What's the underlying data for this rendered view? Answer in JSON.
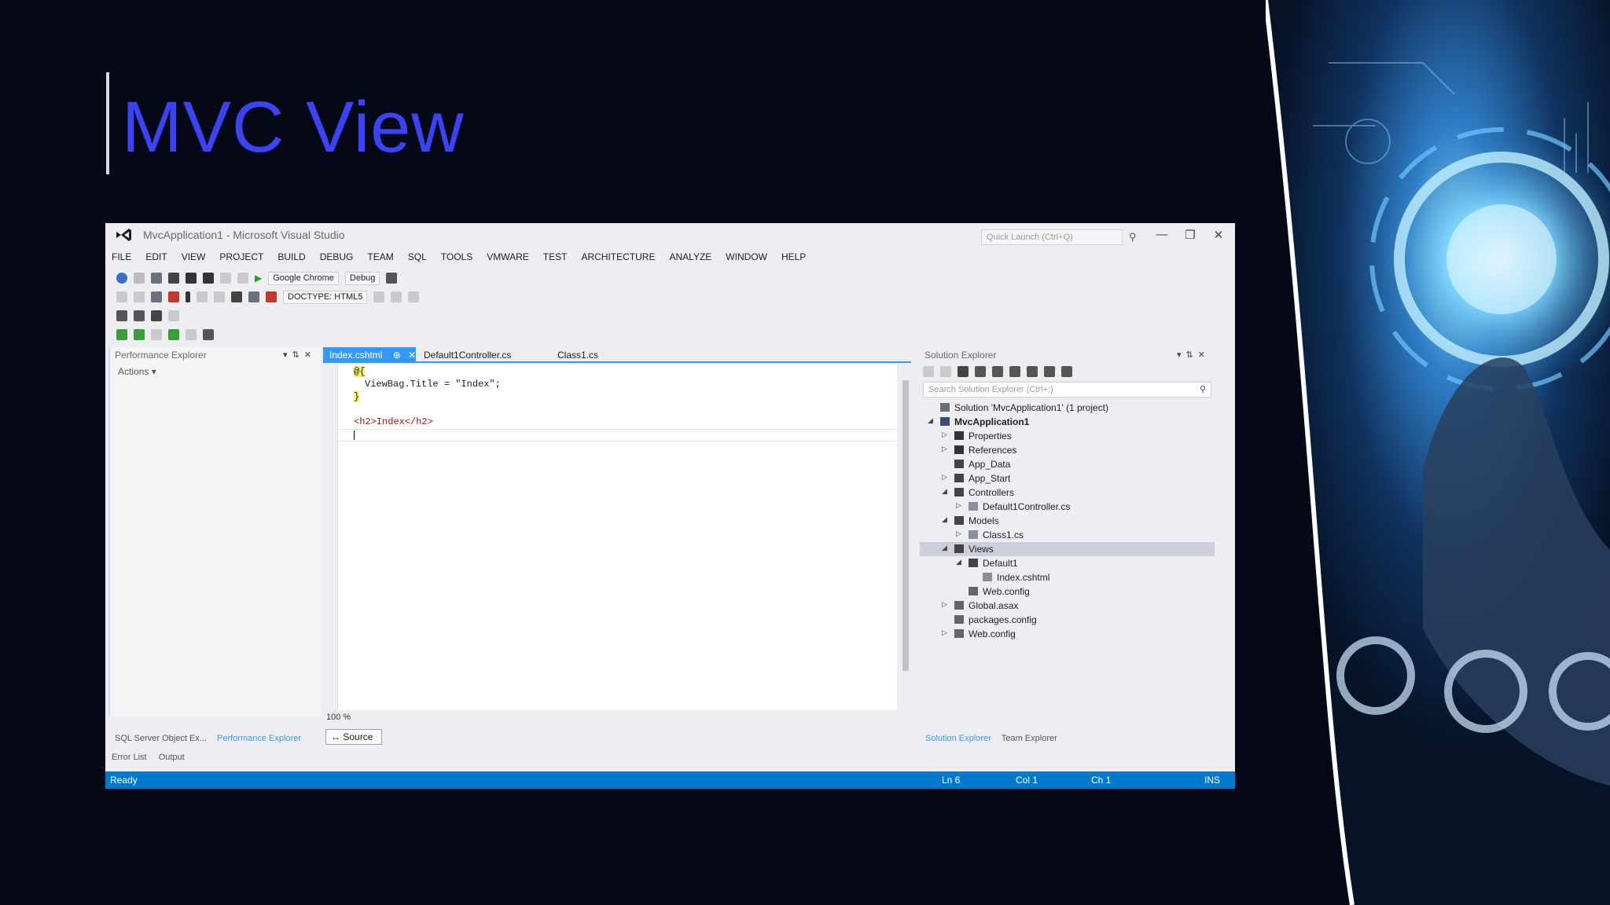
{
  "slide": {
    "title": "MVC View"
  },
  "window": {
    "title": "MvcApplication1 - Microsoft Visual Studio",
    "quick_launch_placeholder": "Quick Launch (Ctrl+Q)"
  },
  "menu": [
    "FILE",
    "EDIT",
    "VIEW",
    "PROJECT",
    "BUILD",
    "DEBUG",
    "TEAM",
    "SQL",
    "TOOLS",
    "VMWARE",
    "TEST",
    "ARCHITECTURE",
    "ANALYZE",
    "WINDOW",
    "HELP"
  ],
  "toolbar": {
    "browser": "Google Chrome",
    "config": "Debug",
    "doctype": "DOCTYPE: HTML5"
  },
  "left_panel": {
    "title": "Performance Explorer",
    "actions": "Actions"
  },
  "tabs": [
    "Index.cshtml",
    "Default1Controller.cs",
    "Class1.cs"
  ],
  "code": {
    "line1": "@{",
    "line2": "ViewBag.Title = \"Index\";",
    "line3": "}",
    "line4": "<h2>Index</h2>"
  },
  "zoom": "100 %",
  "source_button": "Source",
  "solution_explorer": {
    "title": "Solution Explorer",
    "search_placeholder": "Search Solution Explorer (Ctrl+;)",
    "items": [
      {
        "label": "Solution 'MvcApplication1' (1 project)",
        "level": 0,
        "arrow": "",
        "icon": "solution-icon"
      },
      {
        "label": "MvcApplication1",
        "level": 0,
        "arrow": "open",
        "icon": "project-icon"
      },
      {
        "label": "Properties",
        "level": 1,
        "arrow": "closed",
        "icon": "wrench-icon"
      },
      {
        "label": "References",
        "level": 1,
        "arrow": "closed",
        "icon": "references-icon"
      },
      {
        "label": "App_Data",
        "level": 1,
        "arrow": "",
        "icon": "folder-icon"
      },
      {
        "label": "App_Start",
        "level": 1,
        "arrow": "closed",
        "icon": "folder-icon"
      },
      {
        "label": "Controllers",
        "level": 1,
        "arrow": "open",
        "icon": "folder-icon"
      },
      {
        "label": "Default1Controller.cs",
        "level": 2,
        "arrow": "closed",
        "icon": "csharp-file-icon"
      },
      {
        "label": "Models",
        "level": 1,
        "arrow": "open",
        "icon": "folder-icon"
      },
      {
        "label": "Class1.cs",
        "level": 2,
        "arrow": "closed",
        "icon": "csharp-file-icon"
      },
      {
        "label": "Views",
        "level": 1,
        "arrow": "open",
        "icon": "folder-icon"
      },
      {
        "label": "Default1",
        "level": 2,
        "arrow": "open",
        "icon": "folder-icon"
      },
      {
        "label": "Index.cshtml",
        "level": 3,
        "arrow": "",
        "icon": "cshtml-file-icon"
      },
      {
        "label": "Web.config",
        "level": 2,
        "arrow": "",
        "icon": "config-file-icon"
      },
      {
        "label": "Global.asax",
        "level": 1,
        "arrow": "closed",
        "icon": "config-file-icon"
      },
      {
        "label": "packages.config",
        "level": 1,
        "arrow": "",
        "icon": "config-file-icon"
      },
      {
        "label": "Web.config",
        "level": 1,
        "arrow": "closed",
        "icon": "config-file-icon"
      }
    ]
  },
  "bottom_tabs_left": [
    "SQL Server Object Ex...",
    "Performance Explorer"
  ],
  "bottom_tabs_right": [
    "Solution Explorer",
    "Team Explorer"
  ],
  "bottom_tabs_lower": [
    "Error List",
    "Output"
  ],
  "status": {
    "state": "Ready",
    "line": "Ln 6",
    "col": "Col 1",
    "ch": "Ch 1",
    "mode": "INS"
  },
  "colors": {
    "title": "#3b43f5",
    "accent": "#007acc",
    "tab_active": "#3399ff",
    "background": "#050817"
  }
}
